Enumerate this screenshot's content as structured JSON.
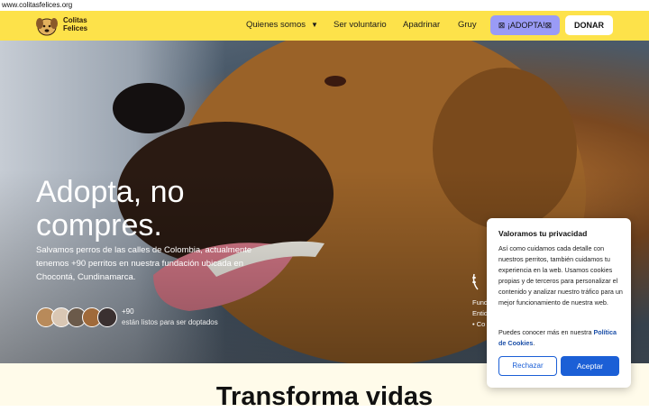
{
  "browser": {
    "url": "www.colitasfelices.org"
  },
  "nav": {
    "logo_text": "Colitas Felices",
    "items": [
      "Quienes somos",
      "Ser voluntario",
      "Apadrinar",
      "Gruy"
    ],
    "adopta_label": "⊠ ¡ADOPTA!⊠",
    "donar_label": "DONAR",
    "bg_color": "#fde24a",
    "adopta_color": "#9a9bf6"
  },
  "hero": {
    "title": "Adopta, no compres.",
    "subtitle": "Salvamos perros de las calles de Colombia, actualmente tenemos +90 perritos en nuestra fundación ubicada en Chocontá, Cundinamarca.",
    "count": "+90",
    "count_caption": "están listos para ser doptados",
    "side_partial": [
      "Fund",
      "Entid",
      "• Co"
    ]
  },
  "section": {
    "title": "Transforma vidas"
  },
  "cookie": {
    "title": "Valoramos tu privacidad",
    "body": "Así como cuidamos cada detalle con nuestros perritos, también cuidamos tu experiencia en la web. Usamos cookies propias y de terceros para personalizar el contenido y analizar nuestro tráfico para un mejor funcionamiento de nuestra web.",
    "more_prefix": "Puedes conocer más en nuestra ",
    "more_link": "Política de Cookies",
    "more_suffix": ".",
    "reject_label": "Rechazar",
    "accept_label": "Aceptar",
    "accent_color": "#1b5fd6"
  }
}
